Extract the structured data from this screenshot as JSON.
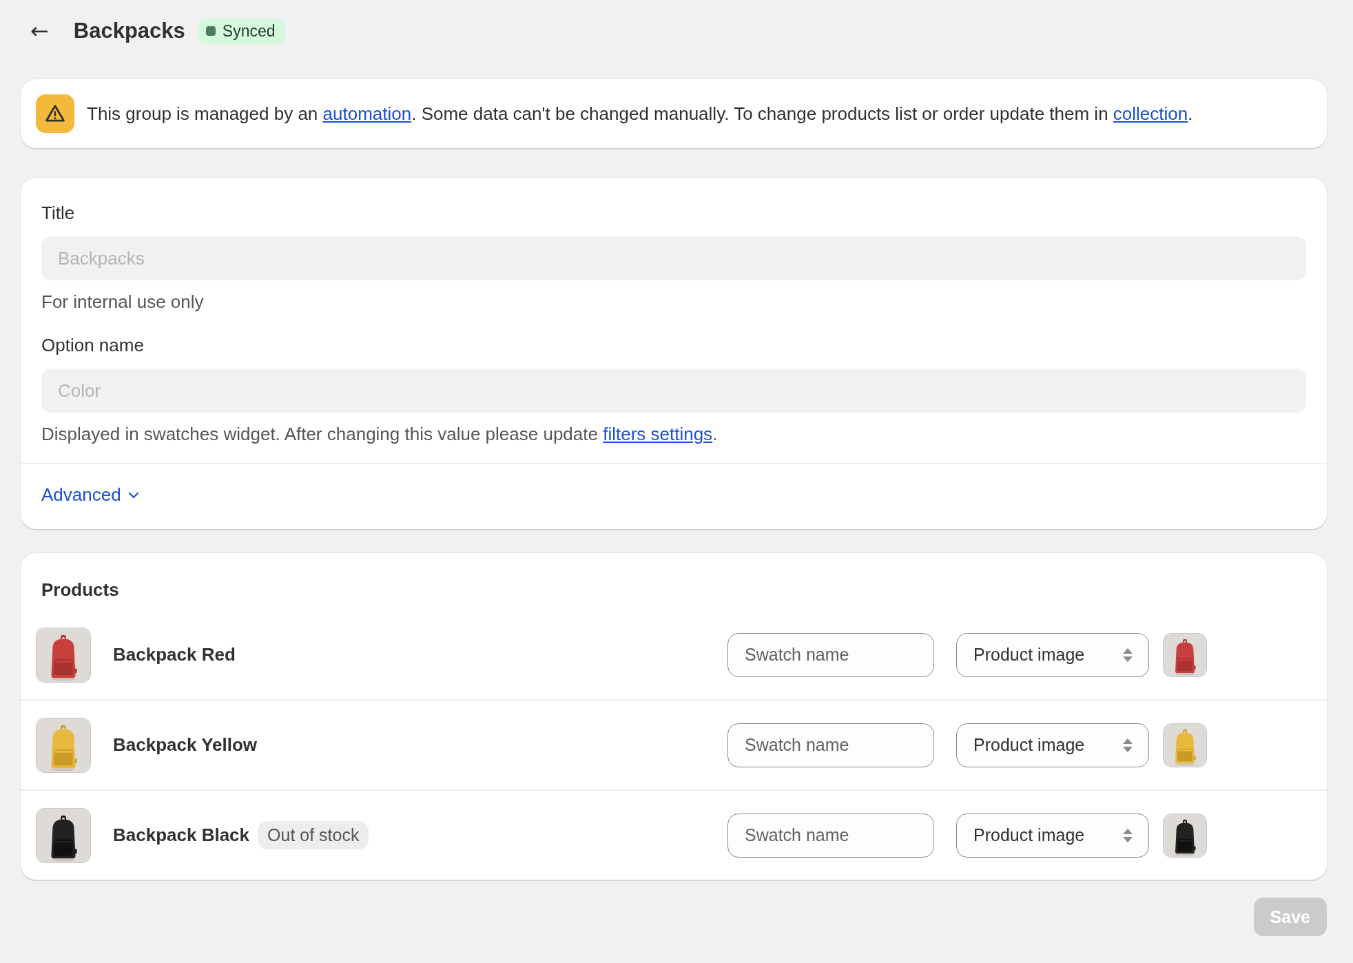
{
  "header": {
    "back": "←",
    "title": "Backpacks",
    "status": {
      "label": "Synced",
      "color": "#4a7d5c"
    }
  },
  "banner": {
    "parts": [
      "This group is managed by an ",
      "automation",
      ". Some data can't be changed manually. To change products list or order update them in ",
      "collection",
      "."
    ]
  },
  "form": {
    "fields": [
      {
        "label": "Title",
        "value": "Backpacks",
        "disabled": true,
        "help": [
          "For internal use only"
        ]
      },
      {
        "label": "Option name",
        "value": "Color",
        "disabled": true,
        "help": [
          "Displayed in swatches widget. After changing this value please update ",
          "filters settings",
          "."
        ]
      }
    ],
    "advanced": {
      "label": "Advanced",
      "expanded": false
    }
  },
  "products": {
    "heading": "Products",
    "rows": [
      {
        "name": "Backpack Red",
        "swatch_placeholder": "Swatch name",
        "image_source": "Product image"
      },
      {
        "name": "Backpack Yellow",
        "swatch_placeholder": "Swatch name",
        "image_source": "Product image"
      },
      {
        "name": "Backpack Black",
        "badge": "Out of stock",
        "swatch_placeholder": "Swatch name",
        "image_source": "Product image"
      }
    ]
  },
  "save": {
    "label": "Save",
    "disabled": true
  }
}
